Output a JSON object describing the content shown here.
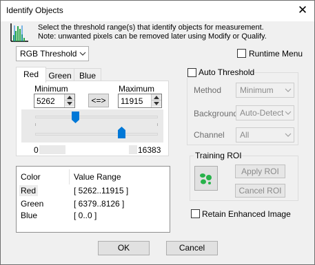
{
  "window": {
    "title": "Identify Objects",
    "close_symbol": "✕"
  },
  "description": {
    "line1": "Select the threshold range(s) that identify objects for measurement.",
    "line2": "Note: unwanted pixels can be removed later using Modify or Qualify."
  },
  "mode_select": {
    "value": "RGB Threshold"
  },
  "runtime_menu": {
    "label": "Runtime Menu",
    "checked": false
  },
  "tabs": [
    {
      "label": "Red",
      "active": true
    },
    {
      "label": "Green",
      "active": false
    },
    {
      "label": "Blue",
      "active": false
    }
  ],
  "range": {
    "minimum_label": "Minimum",
    "maximum_label": "Maximum",
    "minimum_value": "5262",
    "maximum_value": "11915",
    "swap_label": "<=>",
    "scale_min": "0",
    "scale_max": "16383"
  },
  "auto_threshold": {
    "label": "Auto Threshold",
    "checked": false,
    "method_label": "Method",
    "method_value": "Minimum",
    "background_label": "Background",
    "background_value": "Auto-Detect",
    "channel_label": "Channel",
    "channel_value": "All"
  },
  "training_roi": {
    "title": "Training ROI",
    "apply_label": "Apply ROI",
    "cancel_label": "Cancel ROI",
    "icon_color": "#27b24a"
  },
  "value_table": {
    "col_color": "Color",
    "col_range": "Value Range",
    "rows": [
      {
        "color": "Red",
        "range": "[ 5262..11915 ]"
      },
      {
        "color": "Green",
        "range": "[ 6379..8126 ]"
      },
      {
        "color": "Blue",
        "range": "[ 0..0 ]"
      }
    ]
  },
  "retain_enhanced": {
    "label": "Retain Enhanced Image",
    "checked": false
  },
  "buttons": {
    "ok": "OK",
    "cancel": "Cancel"
  },
  "colors": {
    "accent": "#0078d7",
    "histogram": "#28a745"
  }
}
